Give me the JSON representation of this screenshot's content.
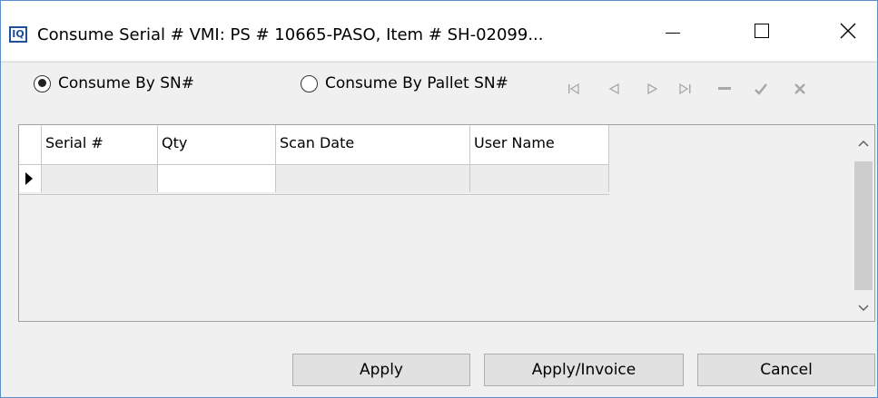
{
  "window": {
    "app_icon_text": "IQ",
    "title": "Consume Serial # VMI: PS # 10665-PASO, Item # SH-02099...",
    "controls": {
      "minimize": "—",
      "maximize": "☐",
      "close": "✕"
    }
  },
  "toolbar": {
    "radio_sn": {
      "label": "Consume By SN#",
      "checked": true
    },
    "radio_pallet": {
      "label": "Consume By Pallet SN#",
      "checked": false
    },
    "nav_icons": {
      "first": "|◀",
      "prior": "◀",
      "next": "▶",
      "last": "▶|",
      "delete": "━",
      "post": "✔",
      "cancel": "✖"
    }
  },
  "grid": {
    "columns": [
      "Serial #",
      "Qty",
      "Scan Date",
      "User Name"
    ],
    "rows": [
      [
        "",
        "",
        "",
        ""
      ]
    ],
    "scroll_icons": {
      "up": "▲",
      "down": "▼"
    }
  },
  "buttons": {
    "apply": "Apply",
    "apply_invoice": "Apply/Invoice",
    "cancel": "Cancel"
  }
}
